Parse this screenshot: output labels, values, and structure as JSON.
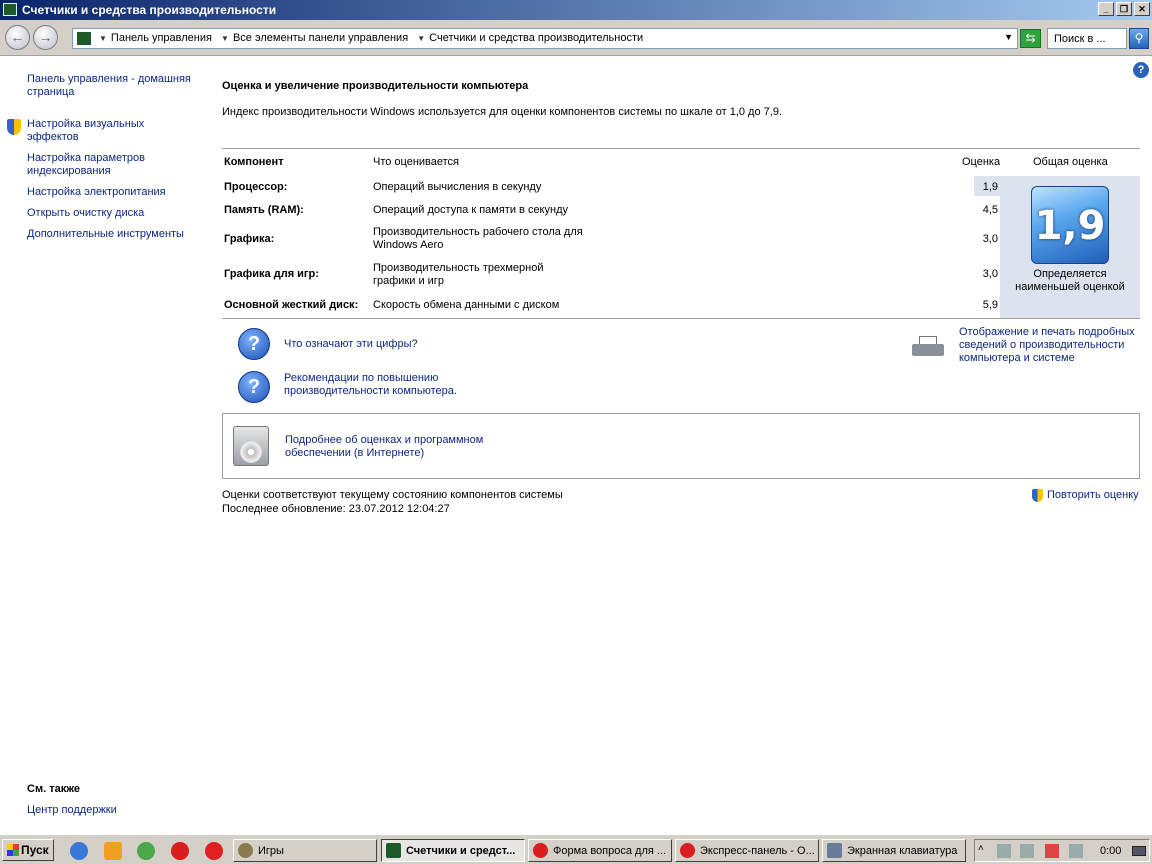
{
  "window": {
    "title": "Счетчики и средства производительности",
    "controls": [
      "_",
      "❐",
      "✕"
    ]
  },
  "address_bar": {
    "crumbs": [
      "Панель управления",
      "Все элементы панели управления",
      "Счетчики и средства производительности"
    ],
    "search_placeholder": "Поиск в ..."
  },
  "sidebar": {
    "items": [
      {
        "label": "Панель управления - домашняя страница",
        "shield": false
      },
      {
        "label": "Настройка визуальных эффектов",
        "shield": true
      },
      {
        "label": "Настройка параметров индексирования",
        "shield": false
      },
      {
        "label": "Настройка электропитания",
        "shield": false
      },
      {
        "label": "Открыть очистку диска",
        "shield": false
      },
      {
        "label": "Дополнительные инструменты",
        "shield": false
      }
    ],
    "see_also": "См. также",
    "see_also_items": [
      "Центр поддержки"
    ]
  },
  "main": {
    "heading": "Оценка и увеличение производительности компьютера",
    "intro": "Индекс производительности Windows используется для оценки компонентов системы по шкале от 1,0 до 7,9.",
    "table": {
      "headers": {
        "component": "Компонент",
        "rated": "Что оценивается",
        "score": "Оценка",
        "base": "Общая оценка"
      },
      "rows": [
        {
          "component": "Процессор:",
          "desc": "Операций вычисления в секунду",
          "score": "1,9"
        },
        {
          "component": "Память (RAM):",
          "desc": "Операций доступа к памяти в секунду",
          "score": "4,5"
        },
        {
          "component": "Графика:",
          "desc": "Производительность рабочего стола для Windows Aero",
          "score": "3,0"
        },
        {
          "component": "Графика для игр:",
          "desc": "Производительность трехмерной графики и игр",
          "score": "3,0"
        },
        {
          "component": "Основной жесткий диск:",
          "desc": "Скорость обмена данными с диском",
          "score": "5,9"
        }
      ],
      "base_score": "1,9",
      "base_caption": "Определяется наименьшей оценкой"
    },
    "links": {
      "what_numbers": "Что означают эти цифры?",
      "tips": "Рекомендации по повышению производительности компьютера.",
      "print_details": "Отображение и печать подробных сведений о производительности компьютера и системе",
      "online_info": "Подробнее об оценках и программном обеспечении (в Интернете)"
    },
    "status": {
      "current": "Оценки соответствуют текущему состоянию компонентов системы",
      "last_update": "Последнее обновление: 23.07.2012 12:04:27",
      "rerun": "Повторить оценку"
    }
  },
  "taskbar": {
    "start": "Пуск",
    "tasks": [
      {
        "label": "Игры",
        "active": false
      },
      {
        "label": "Счетчики и средст...",
        "active": true
      },
      {
        "label": "Форма вопроса для ...",
        "active": false
      },
      {
        "label": "Экспресс-панель - О...",
        "active": false
      },
      {
        "label": "Экранная клавиатура",
        "active": false
      }
    ],
    "clock": "0:00"
  },
  "colors": {
    "link": "#0c2780",
    "title_gradient_start": "#0a246a",
    "panel_bg": "#dde3ee",
    "badge_blue": "#1f5eb8"
  }
}
